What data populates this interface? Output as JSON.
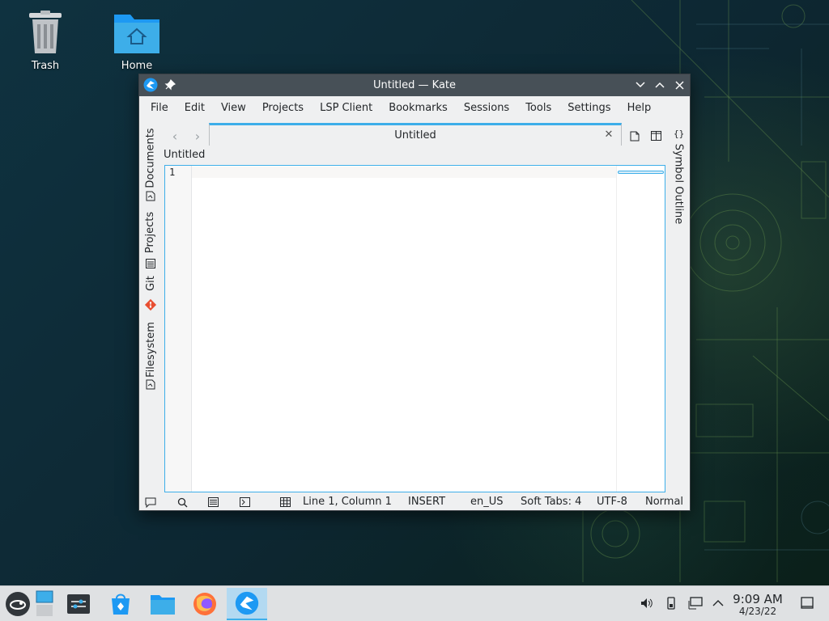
{
  "desktop": {
    "icons": [
      {
        "label": "Trash"
      },
      {
        "label": "Home"
      }
    ]
  },
  "window": {
    "title": "Untitled — Kate",
    "menu": [
      "File",
      "Edit",
      "View",
      "Projects",
      "LSP Client",
      "Bookmarks",
      "Sessions",
      "Tools",
      "Settings",
      "Help"
    ],
    "left_panels": [
      "Documents",
      "Projects",
      "Git",
      "Filesystem"
    ],
    "right_panels": [
      "Symbol Outline"
    ],
    "tab": {
      "label": "Untitled"
    },
    "breadcrumb": "Untitled",
    "editor": {
      "line_number": "1"
    },
    "status": {
      "position": "Line 1, Column 1",
      "mode": "INSERT",
      "dictionary": "en_US",
      "indent": "Soft Tabs: 4",
      "encoding": "UTF-8",
      "syntax": "Normal"
    }
  },
  "taskbar": {
    "clock_time": "9:09 AM",
    "clock_date": "4/23/22"
  },
  "colors": {
    "accent": "#3daee9",
    "titlebar": "#475057",
    "window_bg": "#eff0f1",
    "taskbar_bg": "#dfe1e3"
  }
}
